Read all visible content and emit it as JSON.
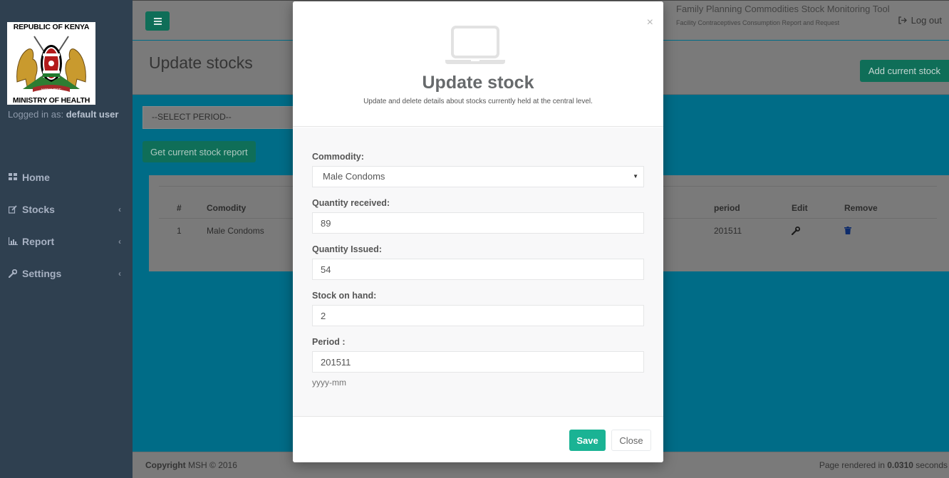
{
  "sidebar": {
    "logo_top_text": "REPUBLIC OF KENYA",
    "logo_bottom_text": "MINISTRY OF HEALTH",
    "logged_in_prefix": "Logged in as:",
    "logged_in_user": "default user",
    "items": [
      {
        "label": "Home",
        "icon": "grid-icon"
      },
      {
        "label": "Stocks",
        "icon": "edit-icon"
      },
      {
        "label": "Report",
        "icon": "bar-chart-icon"
      },
      {
        "label": "Settings",
        "icon": "wrench-icon"
      }
    ]
  },
  "header": {
    "app_title": "Family Planning Commodities Stock Monitoring Tool",
    "app_subtitle": "Facility Contraceptives Consumption Report and Request",
    "logout_label": "Log out"
  },
  "page": {
    "title": "Update stocks",
    "add_button": "Add current stock",
    "period_select": "--SELECT PERIOD--",
    "report_button": "Get current stock report"
  },
  "table": {
    "headers": [
      "#",
      "Comodity",
      "period",
      "Edit",
      "Remove"
    ],
    "rows": [
      {
        "num": "1",
        "commodity": "Male Condoms",
        "period": "201511"
      }
    ]
  },
  "modal": {
    "title": "Update stock",
    "description": "Update and delete details about stocks currently held at the central level.",
    "close_symbol": "×",
    "fields": {
      "commodity_label": "Commodity:",
      "commodity_value": "Male Condoms",
      "qty_received_label": "Quantity received:",
      "qty_received_value": "89",
      "qty_issued_label": "Quantity Issued:",
      "qty_issued_value": "54",
      "stock_on_hand_label": "Stock on hand:",
      "stock_on_hand_value": "2",
      "period_label": "Period :",
      "period_value": "201511",
      "period_help": "yyyy-mm"
    },
    "save_button": "Save",
    "close_button": "Close"
  },
  "footer": {
    "copyright_bold": "Copyright",
    "copyright_text": "MSH © 2016",
    "render_prefix": "Page rendered in",
    "render_time": "0.0310",
    "render_suffix": "seconds"
  },
  "colors": {
    "accent": "#1ab394",
    "sidebar": "#2f4050",
    "main_bg_overlay": "#006c87"
  }
}
